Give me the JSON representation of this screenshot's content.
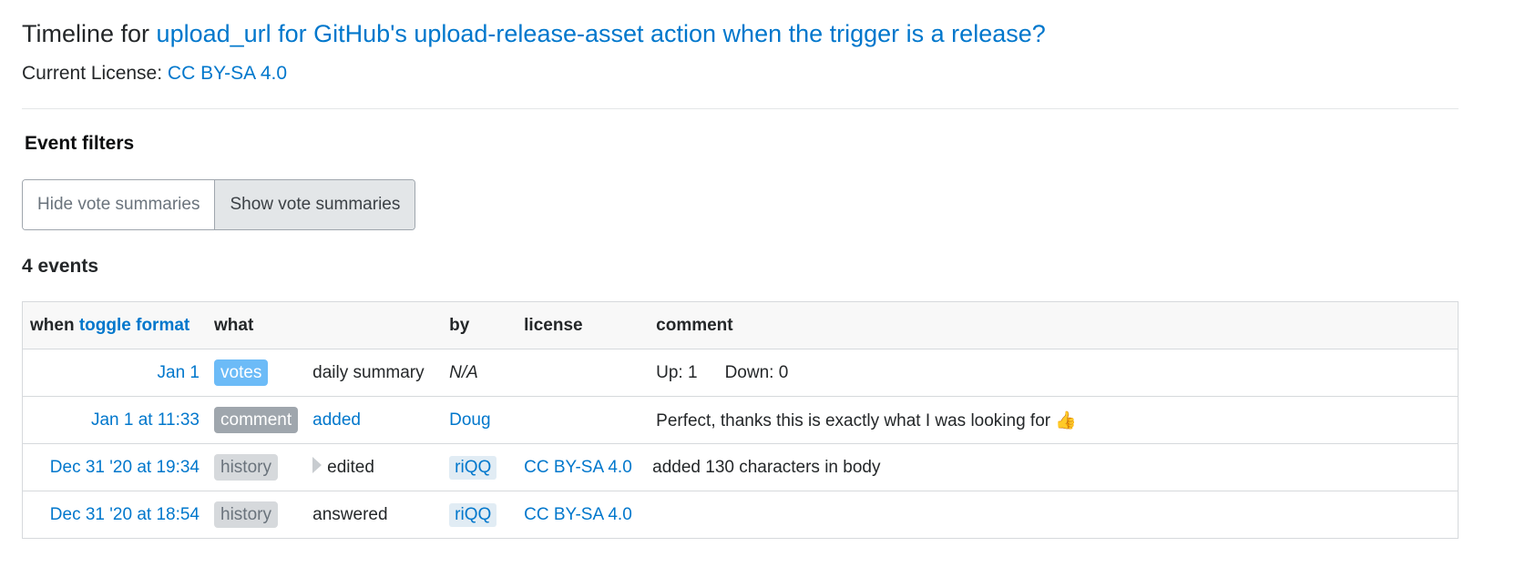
{
  "header": {
    "title_prefix": "Timeline for ",
    "question_title": "upload_url for GitHub's upload-release-asset action when the trigger is a release?",
    "license_label": "Current License: ",
    "license_value": "CC BY-SA 4.0"
  },
  "filters": {
    "heading": "Event filters",
    "buttons": [
      {
        "label": "Hide vote summaries",
        "selected": false
      },
      {
        "label": "Show vote summaries",
        "selected": true
      }
    ]
  },
  "events_count": "4 events",
  "table": {
    "columns": {
      "when": "when",
      "toggle_format": "toggle format",
      "what": "what",
      "by": "by",
      "license": "license",
      "comment": "comment"
    },
    "rows": [
      {
        "when": "Jan 1",
        "badge": "votes",
        "action": "daily summary",
        "by": "N/A",
        "license": "",
        "comment_up": "Up: 1",
        "comment_down": "Down: 0"
      },
      {
        "when": "Jan 1 at 11:33",
        "badge": "comment",
        "action": "added",
        "by": "Doug",
        "license": "",
        "comment": "Perfect, thanks this is exactly what I was looking for",
        "emoji": "👍"
      },
      {
        "when": "Dec 31 '20 at 19:34",
        "badge": "history",
        "action": "edited",
        "by": "riQQ",
        "license": "CC BY-SA 4.0",
        "comment": "added 130 characters in body"
      },
      {
        "when": "Dec 31 '20 at 18:54",
        "badge": "history",
        "action": "answered",
        "by": "riQQ",
        "license": "CC BY-SA 4.0",
        "comment": ""
      }
    ]
  },
  "colors": {
    "link": "#0077cc",
    "badge_votes": "#6cbbf7",
    "badge_comment": "#9fa6ad",
    "badge_history": "#d6d9dc",
    "user_chip": "#e1ecf4"
  }
}
